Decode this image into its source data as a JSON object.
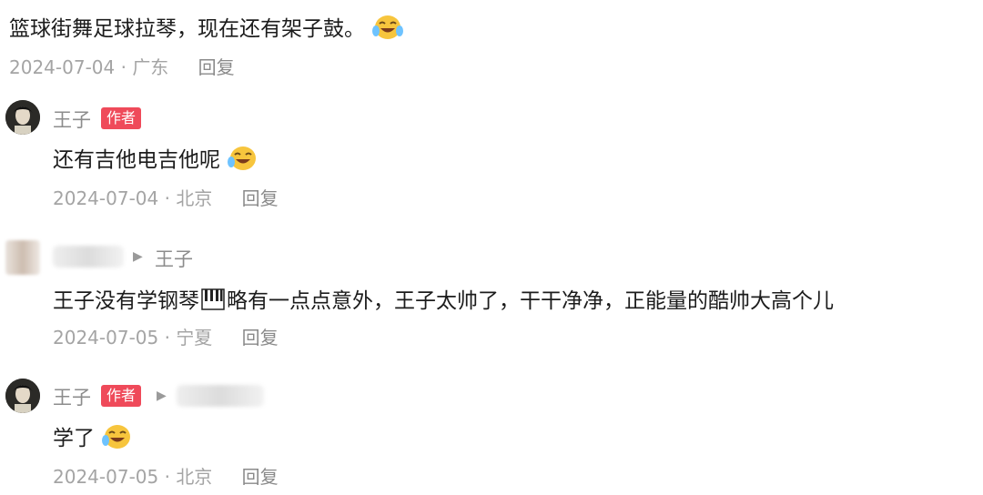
{
  "comment0": {
    "text": "篮球街舞足球拉琴，现在还有架子鼓。",
    "date": "2024-07-04",
    "location": "广东",
    "reply_label": "回复",
    "emoji": "laughing-tears-emoji"
  },
  "reply1": {
    "username": "王子",
    "author_tag": "作者",
    "text": "还有吉他电吉他呢",
    "date": "2024-07-04",
    "location": "北京",
    "reply_label": "回复"
  },
  "reply2": {
    "target_username": "王子",
    "text": "王子没有学钢琴",
    "text_after": "略有一点点意外，王子太帅了，干干净净，正能量的酷帅大高个儿",
    "date": "2024-07-05",
    "location": "宁夏",
    "reply_label": "回复"
  },
  "reply3": {
    "username": "王子",
    "author_tag": "作者",
    "text": "学了",
    "date": "2024-07-05",
    "location": "北京",
    "reply_label": "回复"
  },
  "separator": " · ",
  "colors": {
    "author_tag": "#ef4a5a",
    "meta_text": "#a4a4a4",
    "main_text": "#1c1c1c"
  }
}
